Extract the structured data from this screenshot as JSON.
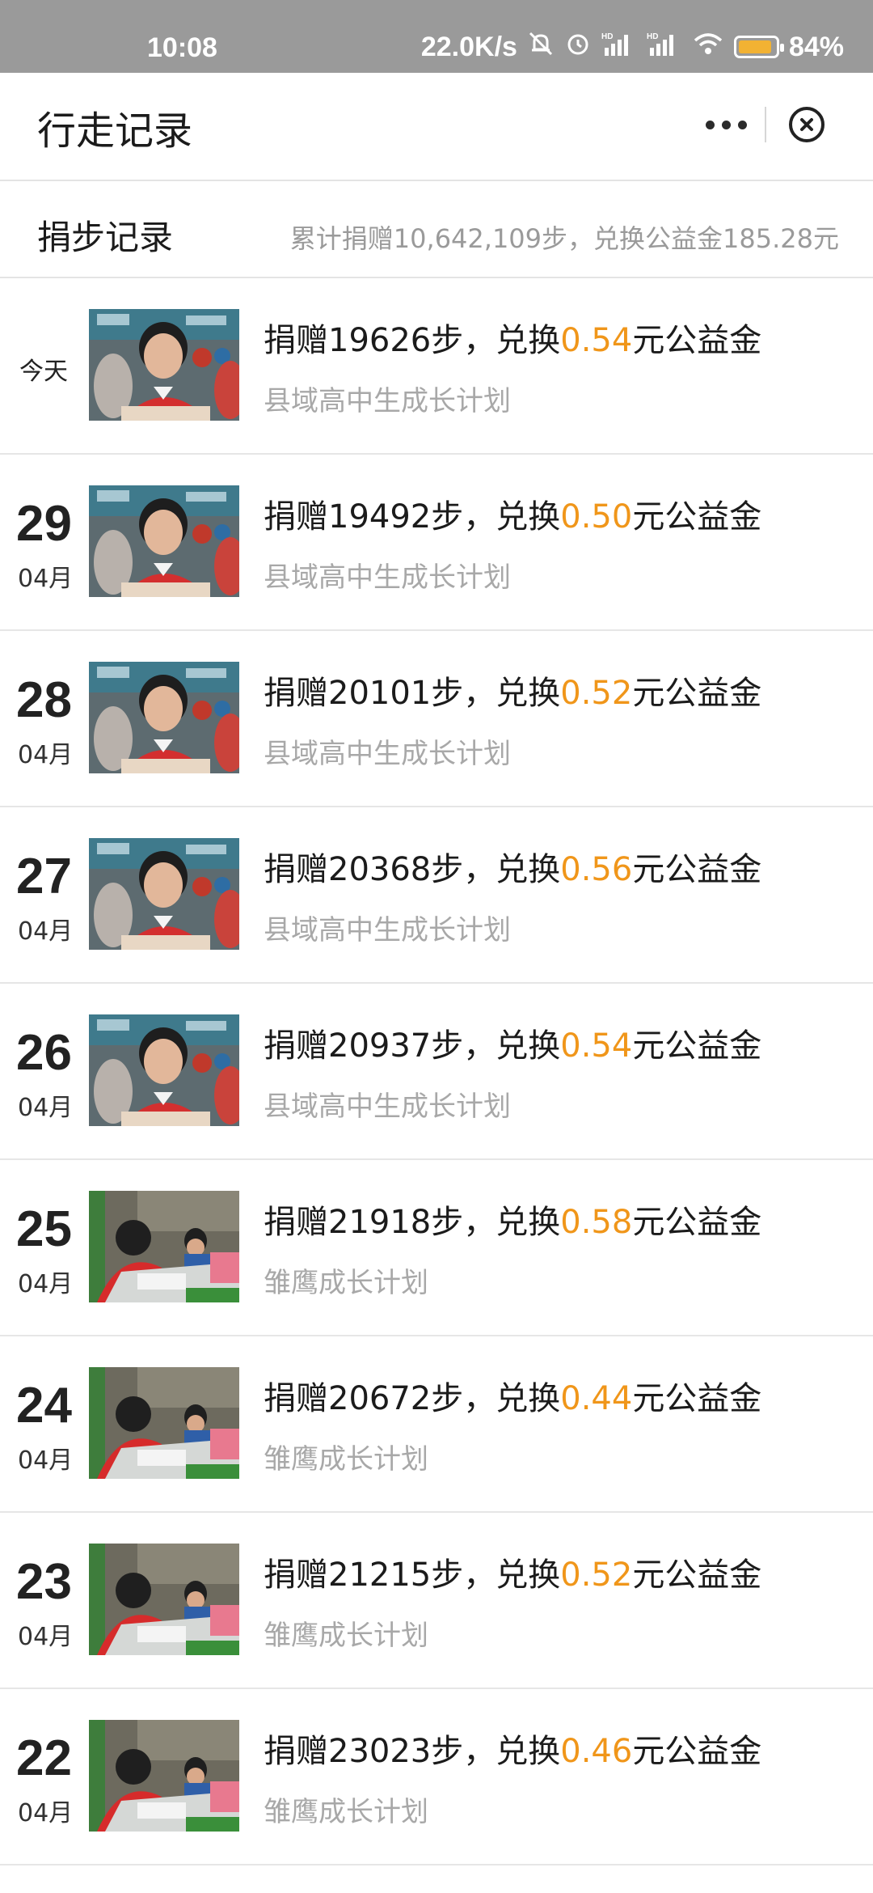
{
  "status_bar": {
    "time": "10:08",
    "speed": "22.0K/s",
    "battery": "84%"
  },
  "header": {
    "title": "行走记录"
  },
  "summary": {
    "label": "捐步记录",
    "total": "累计捐赠10,642,109步，兑换公益金185.28元"
  },
  "records": [
    {
      "today": "今天",
      "day": "",
      "month": "",
      "prefix": "捐赠19626步，兑换",
      "amount": "0.54",
      "suffix": "元公益金",
      "project": "县域高中生成长计划",
      "image": "student-smiling"
    },
    {
      "today": "",
      "day": "29",
      "month": "04月",
      "prefix": "捐赠19492步，兑换",
      "amount": "0.50",
      "suffix": "元公益金",
      "project": "县域高中生成长计划",
      "image": "student-smiling"
    },
    {
      "today": "",
      "day": "28",
      "month": "04月",
      "prefix": "捐赠20101步，兑换",
      "amount": "0.52",
      "suffix": "元公益金",
      "project": "县域高中生成长计划",
      "image": "student-smiling"
    },
    {
      "today": "",
      "day": "27",
      "month": "04月",
      "prefix": "捐赠20368步，兑换",
      "amount": "0.56",
      "suffix": "元公益金",
      "project": "县域高中生成长计划",
      "image": "student-smiling"
    },
    {
      "today": "",
      "day": "26",
      "month": "04月",
      "prefix": "捐赠20937步，兑换",
      "amount": "0.54",
      "suffix": "元公益金",
      "project": "县域高中生成长计划",
      "image": "student-smiling"
    },
    {
      "today": "",
      "day": "25",
      "month": "04月",
      "prefix": "捐赠21918步，兑换",
      "amount": "0.58",
      "suffix": "元公益金",
      "project": "雏鹰成长计划",
      "image": "children-writing"
    },
    {
      "today": "",
      "day": "24",
      "month": "04月",
      "prefix": "捐赠20672步，兑换",
      "amount": "0.44",
      "suffix": "元公益金",
      "project": "雏鹰成长计划",
      "image": "children-writing"
    },
    {
      "today": "",
      "day": "23",
      "month": "04月",
      "prefix": "捐赠21215步，兑换",
      "amount": "0.52",
      "suffix": "元公益金",
      "project": "雏鹰成长计划",
      "image": "children-writing"
    },
    {
      "today": "",
      "day": "22",
      "month": "04月",
      "prefix": "捐赠23023步，兑换",
      "amount": "0.46",
      "suffix": "元公益金",
      "project": "雏鹰成长计划",
      "image": "children-writing"
    }
  ]
}
